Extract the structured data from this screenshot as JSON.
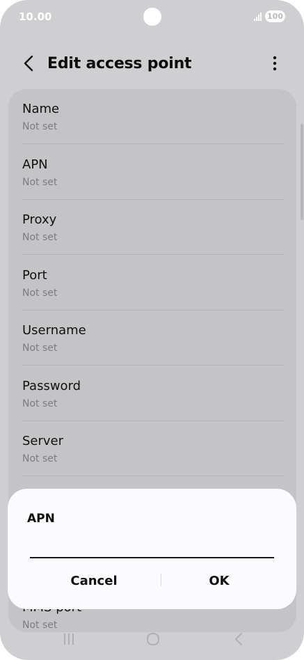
{
  "status_bar": {
    "time": "10.00",
    "battery": "100"
  },
  "app_bar": {
    "title": "Edit access point"
  },
  "settings": [
    {
      "title": "Name",
      "value": "Not set"
    },
    {
      "title": "APN",
      "value": "Not set"
    },
    {
      "title": "Proxy",
      "value": "Not set"
    },
    {
      "title": "Port",
      "value": "Not set"
    },
    {
      "title": "Username",
      "value": "Not set"
    },
    {
      "title": "Password",
      "value": "Not set"
    },
    {
      "title": "Server",
      "value": "Not set"
    },
    {
      "title": "",
      "value": ""
    },
    {
      "title": "",
      "value": ""
    },
    {
      "title": "MMS port",
      "value": "Not set"
    }
  ],
  "dialog": {
    "title": "APN",
    "input_value": "",
    "cancel_label": "Cancel",
    "ok_label": "OK"
  },
  "colors": {
    "background": "#cfcfd2",
    "card": "#c4c4c6",
    "dialog": "#fbfbfd",
    "text": "#111111",
    "subtext": "#7d7d80"
  },
  "icons": {
    "back": "chevron-left-icon",
    "more": "more-vertical-icon",
    "recents": "recents-icon",
    "home": "home-icon",
    "nav_back": "nav-back-icon"
  }
}
